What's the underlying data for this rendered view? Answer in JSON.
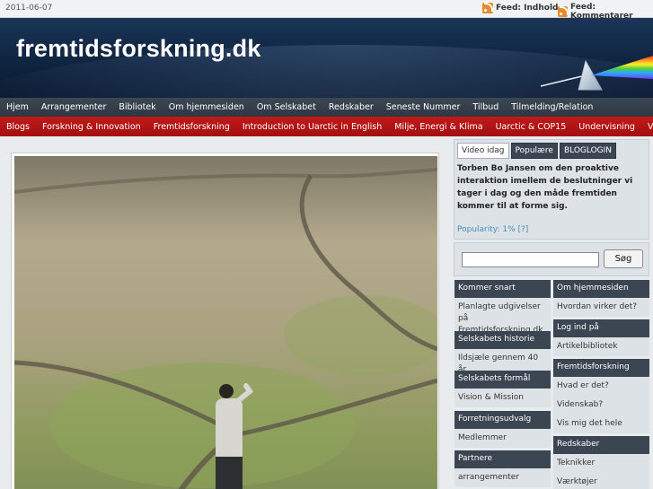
{
  "topbar": {
    "date": "2011-06-07",
    "feeds": [
      {
        "label": "Feed: Indhold",
        "icon": "rss-icon"
      },
      {
        "label": "Feed: Kommentarer",
        "icon": "rss-icon"
      }
    ]
  },
  "header": {
    "title": "fremtidsforskning.dk",
    "logo_icon": "prism-icon"
  },
  "nav_main": [
    "Hjem",
    "Arrangementer",
    "Bibliotek",
    "Om hjemmesiden",
    "Om Selskabet",
    "Redskaber",
    "Seneste Nummer",
    "Tilbud",
    "Tilmelding/Relation"
  ],
  "nav_topics": [
    "Blogs",
    "Forskning & Innovation",
    "Fremtidsforskning",
    "Introduction to Uarctic in English",
    "Milje, Energi & Klima",
    "Uarctic & COP15",
    "Undervisning",
    "Videos"
  ],
  "video_box": {
    "tabs": [
      "Video idag",
      "Populære",
      "BLOGLOGIN"
    ],
    "active_tab": 0,
    "text": "Torben Bo Jansen om den proaktive interaktion imellem de beslutninger vi tager i dag og den måde fremtiden kommer til at forme sig.",
    "popularity_label": "Popularity: 1%",
    "popularity_help": "[?]"
  },
  "search": {
    "placeholder": "",
    "value": "",
    "button": "Søg"
  },
  "sidebar_left": [
    {
      "title": "Kommer snart",
      "items": [
        "Planlagte udgivelser på Fremtidsforskning.dk"
      ]
    },
    {
      "title": "Selskabets historie",
      "items": [
        "Ildsjæle gennem 40 år"
      ]
    },
    {
      "title": "Selskabets formål",
      "items": [
        "Vision & Mission"
      ]
    },
    {
      "title": "Forretningsudvalg",
      "items": [
        "Medlemmer"
      ]
    },
    {
      "title": "Partnere",
      "items": [
        "arrangementer"
      ]
    }
  ],
  "sidebar_right": [
    {
      "title": "Om hjemmesiden",
      "items": [
        "Hvordan virker det?"
      ]
    },
    {
      "title": "Log ind på",
      "items": [
        "Artikelbibliotek"
      ]
    },
    {
      "title": "Fremtidsforskning",
      "items": [
        "Hvad er det?",
        "Videnskab?",
        "Vis mig det hele"
      ]
    },
    {
      "title": "Redskaber",
      "items": [
        "Teknikker",
        "Værktøjer"
      ]
    }
  ],
  "colors": {
    "header_bg": "#0f2440",
    "nav_main_bg": "#333d49",
    "nav_topics_bg": "#b31414",
    "box_header_bg": "#3c4653",
    "rss_orange": "#e98a2c"
  }
}
